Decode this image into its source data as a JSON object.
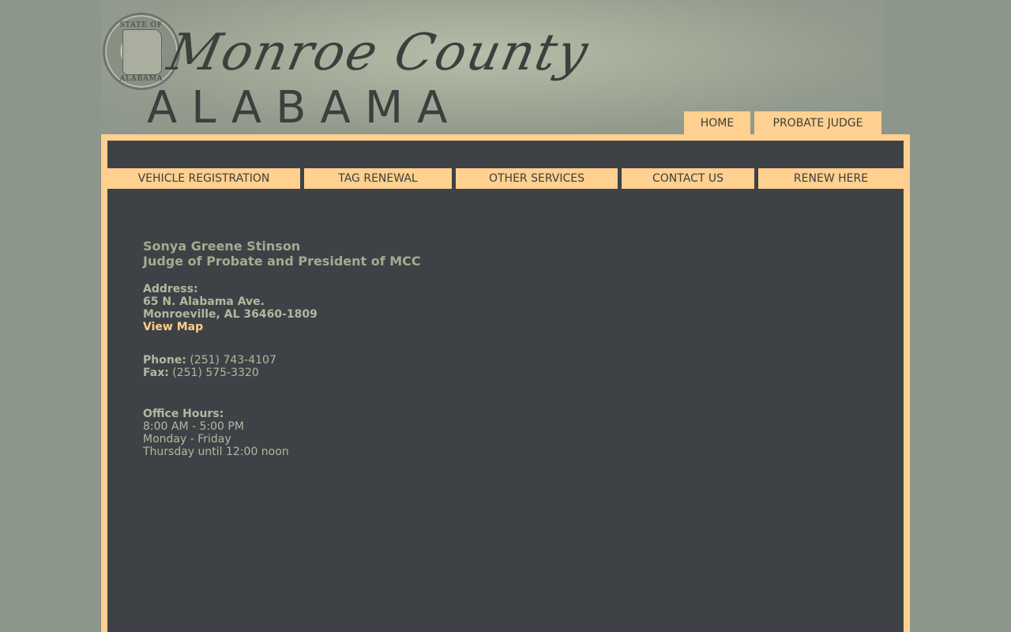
{
  "header": {
    "seal_top_text": "STATE OF",
    "seal_bottom_text": "ALABAMA",
    "script_title": "Monroe County",
    "state_title": "ALABAMA",
    "tabs": [
      {
        "label": "HOME"
      },
      {
        "label": "PROBATE JUDGE"
      }
    ]
  },
  "nav": {
    "items": [
      {
        "label": "VEHICLE REGISTRATION"
      },
      {
        "label": "TAG RENEWAL"
      },
      {
        "label": "OTHER SERVICES"
      },
      {
        "label": "CONTACT US"
      },
      {
        "label": "RENEW HERE"
      }
    ]
  },
  "contact": {
    "name": "Sonya Greene Stinson",
    "title": "Judge of Probate and President of MCC",
    "address_label": "Address:",
    "address_line1": "65 N. Alabama Ave.",
    "address_line2": "Monroeville, AL 36460-1809",
    "map_link": "View Map",
    "phone_label": "Phone:",
    "phone": "(251) 743-4107",
    "fax_label": "Fax:",
    "fax": "(251) 575-3320",
    "hours_label": "Office Hours:",
    "hours_line1": "8:00 AM - 5:00 PM",
    "hours_line2": "Monday - Friday",
    "hours_line3": "Thursday until 12:00 noon"
  },
  "colors": {
    "background": "#8d968b",
    "accent": "#ffd08f",
    "panel": "#3e4246",
    "text": "#b4b79f",
    "heading": "#a5ab8f"
  }
}
